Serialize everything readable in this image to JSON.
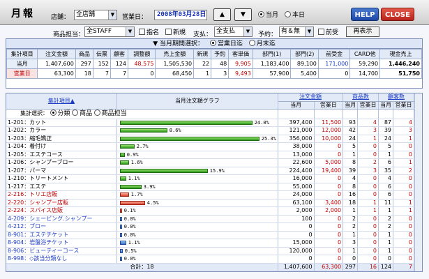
{
  "header": {
    "title": "月報",
    "store_label": "店舗：",
    "store_value": "全店舗",
    "bizday_label": "営業日：",
    "bizday_value": "2008年03月28日",
    "up_btn": "▲",
    "down_btn": "▼",
    "radio_month": "当月",
    "radio_day": "本日",
    "help": "HELP",
    "close": "CLOSE"
  },
  "filters": {
    "staff_label": "商品担当：",
    "staff_value": "全STAFF",
    "chk_nominate": "指名",
    "chk_new": "新規",
    "pay_label": "支払：",
    "pay_value": "全支払",
    "reserve_label": "予約：",
    "reserve_value": "有＆無",
    "chk_advance": "前受",
    "display_btn": "再表示"
  },
  "summary": {
    "title": "▼ 当月期間選択：",
    "radio_bizday": "営業日迄",
    "radio_monthend": "月末迄",
    "headers": [
      "集計項目",
      "注文金額",
      "商品",
      "伝票",
      "顧客",
      "調整額",
      "売上金額",
      "新規",
      "予約",
      "客単価",
      "部門(1)",
      "部門(2)",
      "前受金",
      "CARD他",
      "現金売上"
    ],
    "rows": [
      {
        "label": "当月",
        "cells": [
          "1,407,600",
          "297",
          "152",
          "124",
          "48,575",
          "1,505,530",
          "22",
          "48",
          "9,905",
          "1,183,400",
          "89,100",
          "171,000",
          "59,290",
          "1,446,240"
        ]
      },
      {
        "label": "営業日",
        "cells": [
          "63,300",
          "18",
          "7",
          "7",
          "0",
          "68,450",
          "1",
          "3",
          "9,493",
          "57,900",
          "5,400",
          "0",
          "14,700",
          "51,750"
        ]
      }
    ]
  },
  "main": {
    "col_item": "集計項目▲",
    "col_graph": "当月注文額グラフ",
    "col_amount": "注文金額",
    "col_product": "商品数",
    "col_customer": "顧客数",
    "sub_month": "当月",
    "sub_day": "営業日",
    "select_label": "集計選択：",
    "radio_category": "分類",
    "radio_product": "商品",
    "radio_staff": "商品担当",
    "rows": [
      {
        "name": "1-201：カット",
        "pct": "24.0%",
        "m": "397,400",
        "d": "11,500",
        "pm": "93",
        "pd": "4",
        "cm": "87",
        "cd": "4"
      },
      {
        "name": "1-202：カラー",
        "pct": "8.6%",
        "m": "121,000",
        "d": "12,000",
        "pm": "42",
        "pd": "3",
        "cm": "39",
        "cd": "3"
      },
      {
        "name": "1-203：縮毛矯正",
        "pct": "25.3%",
        "m": "356,000",
        "d": "10,000",
        "pm": "24",
        "pd": "1",
        "cm": "24",
        "cd": "1"
      },
      {
        "name": "1-204：着付け",
        "pct": "2.7%",
        "m": "38,000",
        "d": "0",
        "pm": "5",
        "pd": "0",
        "cm": "5",
        "cd": "0"
      },
      {
        "name": "1-205：エステコース",
        "pct": "0.9%",
        "m": "13,000",
        "d": "0",
        "pm": "1",
        "pd": "0",
        "cm": "1",
        "cd": "0"
      },
      {
        "name": "1-206：シャンプーブロー",
        "pct": "1.6%",
        "m": "22,600",
        "d": "5,000",
        "pm": "8",
        "pd": "2",
        "cm": "6",
        "cd": "1"
      },
      {
        "name": "1-207：パーマ",
        "pct": "15.9%",
        "m": "224,400",
        "d": "19,400",
        "pm": "39",
        "pd": "3",
        "cm": "35",
        "cd": "2"
      },
      {
        "name": "1-210：トリートメント",
        "pct": "1.1%",
        "m": "16,000",
        "d": "0",
        "pm": "4",
        "pd": "0",
        "cm": "4",
        "cd": "0"
      },
      {
        "name": "1-217：エステ",
        "pct": "3.9%",
        "m": "55,000",
        "d": "0",
        "pm": "8",
        "pd": "0",
        "cm": "6",
        "cd": "0"
      },
      {
        "name": "2-216：トリエ店販",
        "pct": "1.7%",
        "m": "24,000",
        "d": "0",
        "pm": "16",
        "pd": "0",
        "cm": "6",
        "cd": "0"
      },
      {
        "name": "2-220：シャンプー店販",
        "pct": "4.5%",
        "m": "63,100",
        "d": "3,400",
        "pm": "18",
        "pd": "1",
        "cm": "11",
        "cd": "1"
      },
      {
        "name": "2-224：スパイス店販",
        "pct": "0.1%",
        "m": "2,000",
        "d": "2,000",
        "pm": "1",
        "pd": "1",
        "cm": "1",
        "cd": "1"
      },
      {
        "name": "4-209：シェービング.シャンプー",
        "pct": "0.0%",
        "m": "100",
        "d": "0",
        "pm": "2",
        "pd": "0",
        "cm": "2",
        "cd": "0"
      },
      {
        "name": "4-212：ブロー",
        "pct": "0.0%",
        "m": "0",
        "d": "0",
        "pm": "2",
        "pd": "0",
        "cm": "2",
        "cd": "0"
      },
      {
        "name": "8-901：エステチケット",
        "pct": "0.0%",
        "m": "0",
        "d": "0",
        "pm": "1",
        "pd": "0",
        "cm": "1",
        "cd": "0"
      },
      {
        "name": "8-904：岩盤浴チケット",
        "pct": "1.1%",
        "m": "15,000",
        "d": "0",
        "pm": "3",
        "pd": "0",
        "cm": "1",
        "cd": "0"
      },
      {
        "name": "8-906：ビューティーコース",
        "pct": "0.5%",
        "m": "120,000",
        "d": "0",
        "pm": "1",
        "pd": "0",
        "cm": "1",
        "cd": "0"
      },
      {
        "name": "8-998：◇該当分類なし",
        "pct": "0.0%",
        "m": "0",
        "d": "0",
        "pm": "0",
        "pd": "0",
        "cm": "0",
        "cd": "0"
      }
    ],
    "total_label": "合計：18",
    "total": {
      "m": "1,407,600",
      "d": "63,300",
      "pm": "297",
      "pd": "16",
      "cm": "124",
      "cd": "7"
    },
    "colors": {
      "group1": "green",
      "group2": "red",
      "group4": "blue",
      "group8": "blue"
    }
  }
}
